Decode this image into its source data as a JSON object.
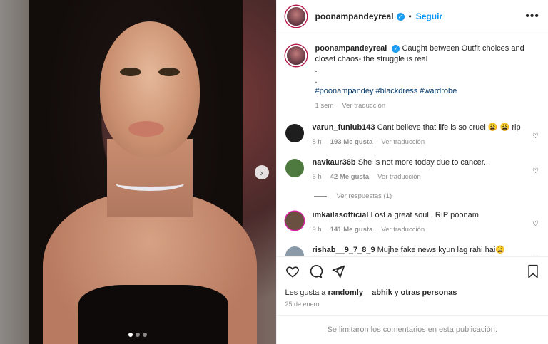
{
  "post": {
    "username": "poonampandeyreal",
    "follow_label": "Seguir",
    "dot": "•",
    "more_icon": "more-horizontal-icon",
    "caption": {
      "username": "poonampandeyreal",
      "text": "Caught between Outfit choices and closet chaos- the struggle is real",
      "dot1": ".",
      "dot2": ".",
      "hashtags": "#poonampandey #blackdress #wardrobe",
      "time": "1 sem",
      "translate": "Ver traducción"
    },
    "comments": [
      {
        "username": "varun_funlub143",
        "text": "Cant believe that life is so cruel 😩 😩 rip",
        "time": "8 h",
        "likes": "193 Me gusta",
        "translate": "Ver traducción",
        "avatar_color": "#1e1e1e"
      },
      {
        "username": "navkaur36b",
        "text": "She is not more today due to cancer...",
        "time": "6 h",
        "likes": "42 Me gusta",
        "translate": "Ver traducción",
        "avatar_color": "#4f7a3f",
        "replies": "Ver respuestas (1)"
      },
      {
        "username": "imkailasofficial",
        "text": "Lost a great soul , RIP poonam",
        "time": "9 h",
        "likes": "141 Me gusta",
        "translate": "Ver traducción",
        "avatar_color": "#6a5040"
      },
      {
        "username": "rishab__9_7_8_9",
        "text": "Mujhe fake news kyun lag rahi hai😩",
        "time": "",
        "likes": "",
        "translate": "",
        "avatar_color": "#8a9aa8"
      }
    ],
    "likes_text_prefix": "Les gusta a",
    "likes_user": "randomly__abhik",
    "likes_suffix": "y",
    "likes_others": "otras personas",
    "date": "25 de enero",
    "comments_limited": "Se limitaron los comentarios en esta publicación."
  },
  "icons": {
    "verified": "✓",
    "next": "›",
    "heart": "♡"
  },
  "carousel": {
    "count": 3,
    "active": 0
  }
}
